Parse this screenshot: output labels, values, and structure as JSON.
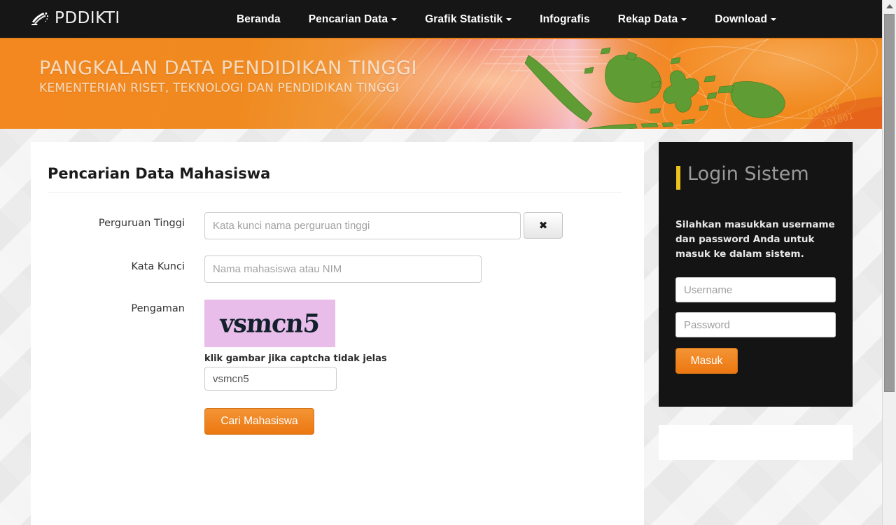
{
  "navbar": {
    "brand": "PDDIKTI",
    "brand_icon": "pddikti-logo-icon",
    "items": [
      {
        "label": "Beranda",
        "caret": false
      },
      {
        "label": "Pencarian Data",
        "caret": true
      },
      {
        "label": "Grafik Statistik",
        "caret": true
      },
      {
        "label": "Infografis",
        "caret": false
      },
      {
        "label": "Rekap Data",
        "caret": true
      },
      {
        "label": "Download",
        "caret": true
      }
    ]
  },
  "banner": {
    "title": "PANGKALAN DATA PENDIDIKAN TINGGI",
    "subtitle": "KEMENTERIAN RISET, TEKNOLOGI DAN PENDIDIKAN TINGGI"
  },
  "search_panel": {
    "title": "Pencarian Data Mahasiswa",
    "fields": {
      "perguruan_tinggi": {
        "label": "Perguruan Tinggi",
        "placeholder": "Kata kunci nama perguruan tinggi",
        "value": "",
        "clear_button": "✖"
      },
      "kata_kunci": {
        "label": "Kata Kunci",
        "placeholder": "Nama mahasiswa atau NIM",
        "value": ""
      },
      "pengaman": {
        "label": "Pengaman",
        "captcha_text": "vsmcn5",
        "captcha_bg": "#e8bde9",
        "hint": "klik gambar jika captcha tidak jelas",
        "input_value": "vsmcn5",
        "input_placeholder": ""
      }
    },
    "submit_label": "Cari Mahasiswa"
  },
  "login": {
    "title": "Login Sistem",
    "accent_color": "#ebc21e",
    "description": "Silahkan masukkan username dan password Anda untuk masuk ke dalam sistem.",
    "username_placeholder": "Username",
    "username_value": "",
    "password_placeholder": "Password",
    "password_value": "",
    "submit_label": "Masuk"
  },
  "theme": {
    "accent_orange": "#ec7711",
    "nav_dark": "#161616",
    "page_bg": "#ececec"
  }
}
